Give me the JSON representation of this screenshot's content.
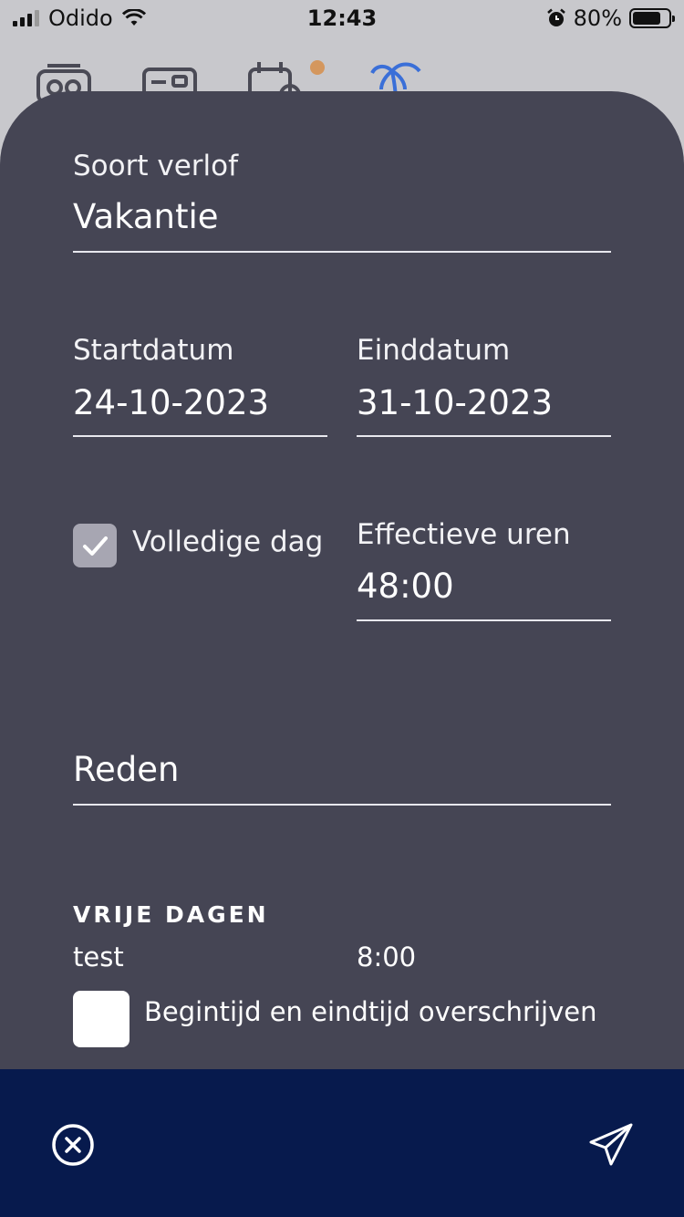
{
  "status_bar": {
    "carrier": "Odido",
    "time": "12:43",
    "battery_percent": "80%",
    "battery_level": 0.8
  },
  "form": {
    "leave_type": {
      "label": "Soort verlof",
      "value": "Vakantie"
    },
    "start_date": {
      "label": "Startdatum",
      "value": "24-10-2023"
    },
    "end_date": {
      "label": "Einddatum",
      "value": "31-10-2023"
    },
    "full_day": {
      "label": "Volledige dag",
      "checked": true
    },
    "effective_hours": {
      "label": "Effectieve uren",
      "value": "48:00"
    },
    "reason": {
      "placeholder": "Reden"
    }
  },
  "free_days": {
    "title": "VRIJE DAGEN",
    "items": [
      {
        "name": "test",
        "hours": "8:00"
      }
    ],
    "override": {
      "label": "Begintijd en eindtijd overschrijven",
      "checked": false
    }
  },
  "icons": {
    "tab_1": "radio-icon",
    "tab_2": "id-card-icon",
    "tab_3": "calendar-clock-icon",
    "tab_4": "palm-tree-icon",
    "close": "close-circle-icon",
    "send": "paper-plane-icon"
  },
  "colors": {
    "sheet_bg": "#454554",
    "bottom_bar_bg": "#071a4d",
    "accent_blue": "#3a6fd8",
    "notification_dot": "#d4975e"
  }
}
